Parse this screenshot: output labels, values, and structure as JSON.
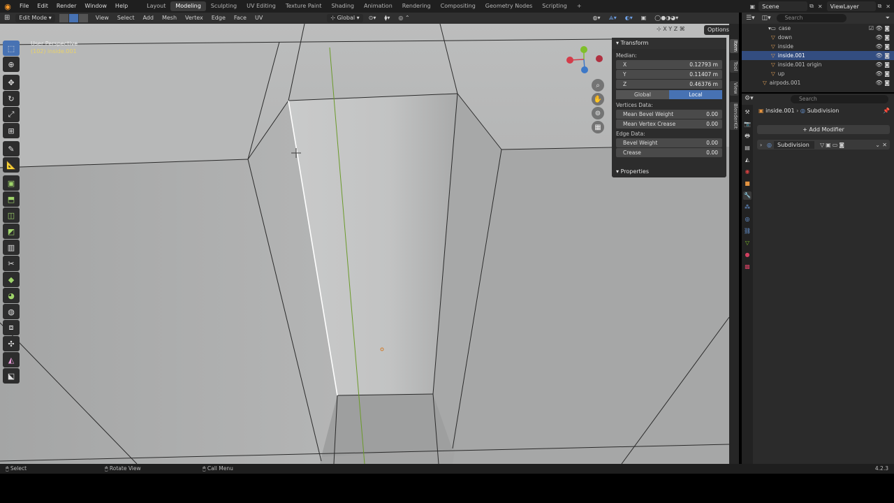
{
  "app": {
    "logo_icon": "blender-logo-icon"
  },
  "topbar": {
    "menus": [
      "File",
      "Edit",
      "Render",
      "Window",
      "Help"
    ],
    "workspaces": [
      "Layout",
      "Modeling",
      "Sculpting",
      "UV Editing",
      "Texture Paint",
      "Shading",
      "Animation",
      "Rendering",
      "Compositing",
      "Geometry Nodes",
      "Scripting"
    ],
    "active_workspace": "Modeling",
    "scene": "Scene",
    "view_layer": "ViewLayer"
  },
  "viewport_header": {
    "mode": "Edit Mode",
    "menus": [
      "View",
      "Select",
      "Add",
      "Mesh",
      "Vertex",
      "Edge",
      "Face",
      "UV"
    ],
    "transform_orientation": "Global",
    "options": "Options",
    "axes": [
      "X",
      "Y",
      "Z"
    ]
  },
  "viewport": {
    "perspective_label": "User Perspective",
    "object_label": "(102) inside.001",
    "gizmo_axes": {
      "x_color": "#d43c4a",
      "y_color": "#7fbf2a",
      "z_color": "#3d78c7"
    }
  },
  "npanel": {
    "transform_title": "Transform",
    "median_label": "Median:",
    "x_label": "X",
    "x_value": "0.12793 m",
    "y_label": "Y",
    "y_value": "0.11407 m",
    "z_label": "Z",
    "z_value": "0.46376 m",
    "global": "Global",
    "local": "Local",
    "vertices_data": "Vertices Data:",
    "mean_bevel_weight": "Mean Bevel Weight",
    "mean_bevel_weight_value": "0.00",
    "mean_vertex_crease": "Mean Vertex Crease",
    "mean_vertex_crease_value": "0.00",
    "edge_data": "Edge Data:",
    "bevel_weight": "Bevel Weight",
    "bevel_weight_value": "0.00",
    "crease": "Crease",
    "crease_value": "0.00",
    "properties_title": "Properties",
    "tabs": [
      "Item",
      "Tool",
      "View",
      "BlenderKit"
    ]
  },
  "outliner": {
    "search_placeholder": "Search",
    "items": [
      {
        "name": "case",
        "selected": false
      },
      {
        "name": "down",
        "selected": false
      },
      {
        "name": "inside",
        "selected": false
      },
      {
        "name": "inside.001",
        "selected": true
      },
      {
        "name": "inside.001 origin",
        "selected": false
      },
      {
        "name": "up",
        "selected": false
      },
      {
        "name": "airpods.001",
        "selected": false
      }
    ]
  },
  "properties": {
    "search_placeholder": "Search",
    "object_name": "inside.001",
    "modifier_context": "Subdivision",
    "add_modifier": "Add Modifier",
    "modifier_name": "Subdivision"
  },
  "statusbar": {
    "select": "Select",
    "rotate": "Rotate View",
    "call_menu": "Call Menu",
    "version": "4.2.3"
  }
}
